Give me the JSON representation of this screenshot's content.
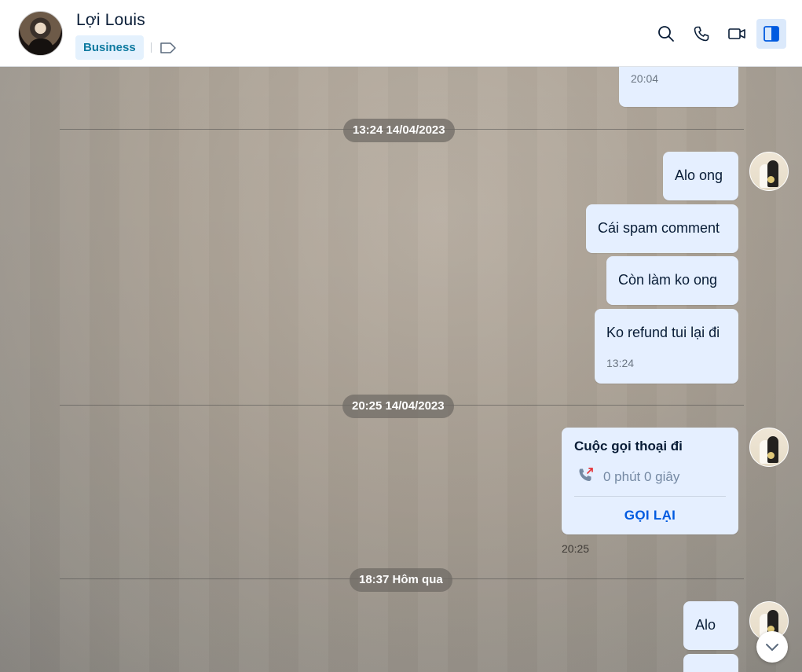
{
  "header": {
    "contact_name": "Lợi Louis",
    "badge": "Business",
    "icons": [
      "tag-icon",
      "search-icon",
      "phone-icon",
      "video-icon",
      "sidebar-toggle-icon"
    ]
  },
  "messages": {
    "partial_stamp": "20:04",
    "separators": [
      "13:24 14/04/2023",
      "20:25 14/04/2023",
      "18:37 Hôm qua"
    ],
    "group1": [
      "Alo ong",
      "Cái spam comment",
      "Còn làm ko ong",
      "Ko refund tui lại đi"
    ],
    "group1_stamp": "13:24",
    "call": {
      "title": "Cuộc gọi thoại đi",
      "duration": "0 phút 0 giây",
      "action": "GỌI LẠI",
      "stamp": "20:25"
    },
    "group3": [
      "Alo"
    ]
  },
  "colors": {
    "bubble": "#e5efff",
    "accent": "#005ae0",
    "badge_bg": "#e4f1fd",
    "badge_text": "#0e7aa0"
  }
}
